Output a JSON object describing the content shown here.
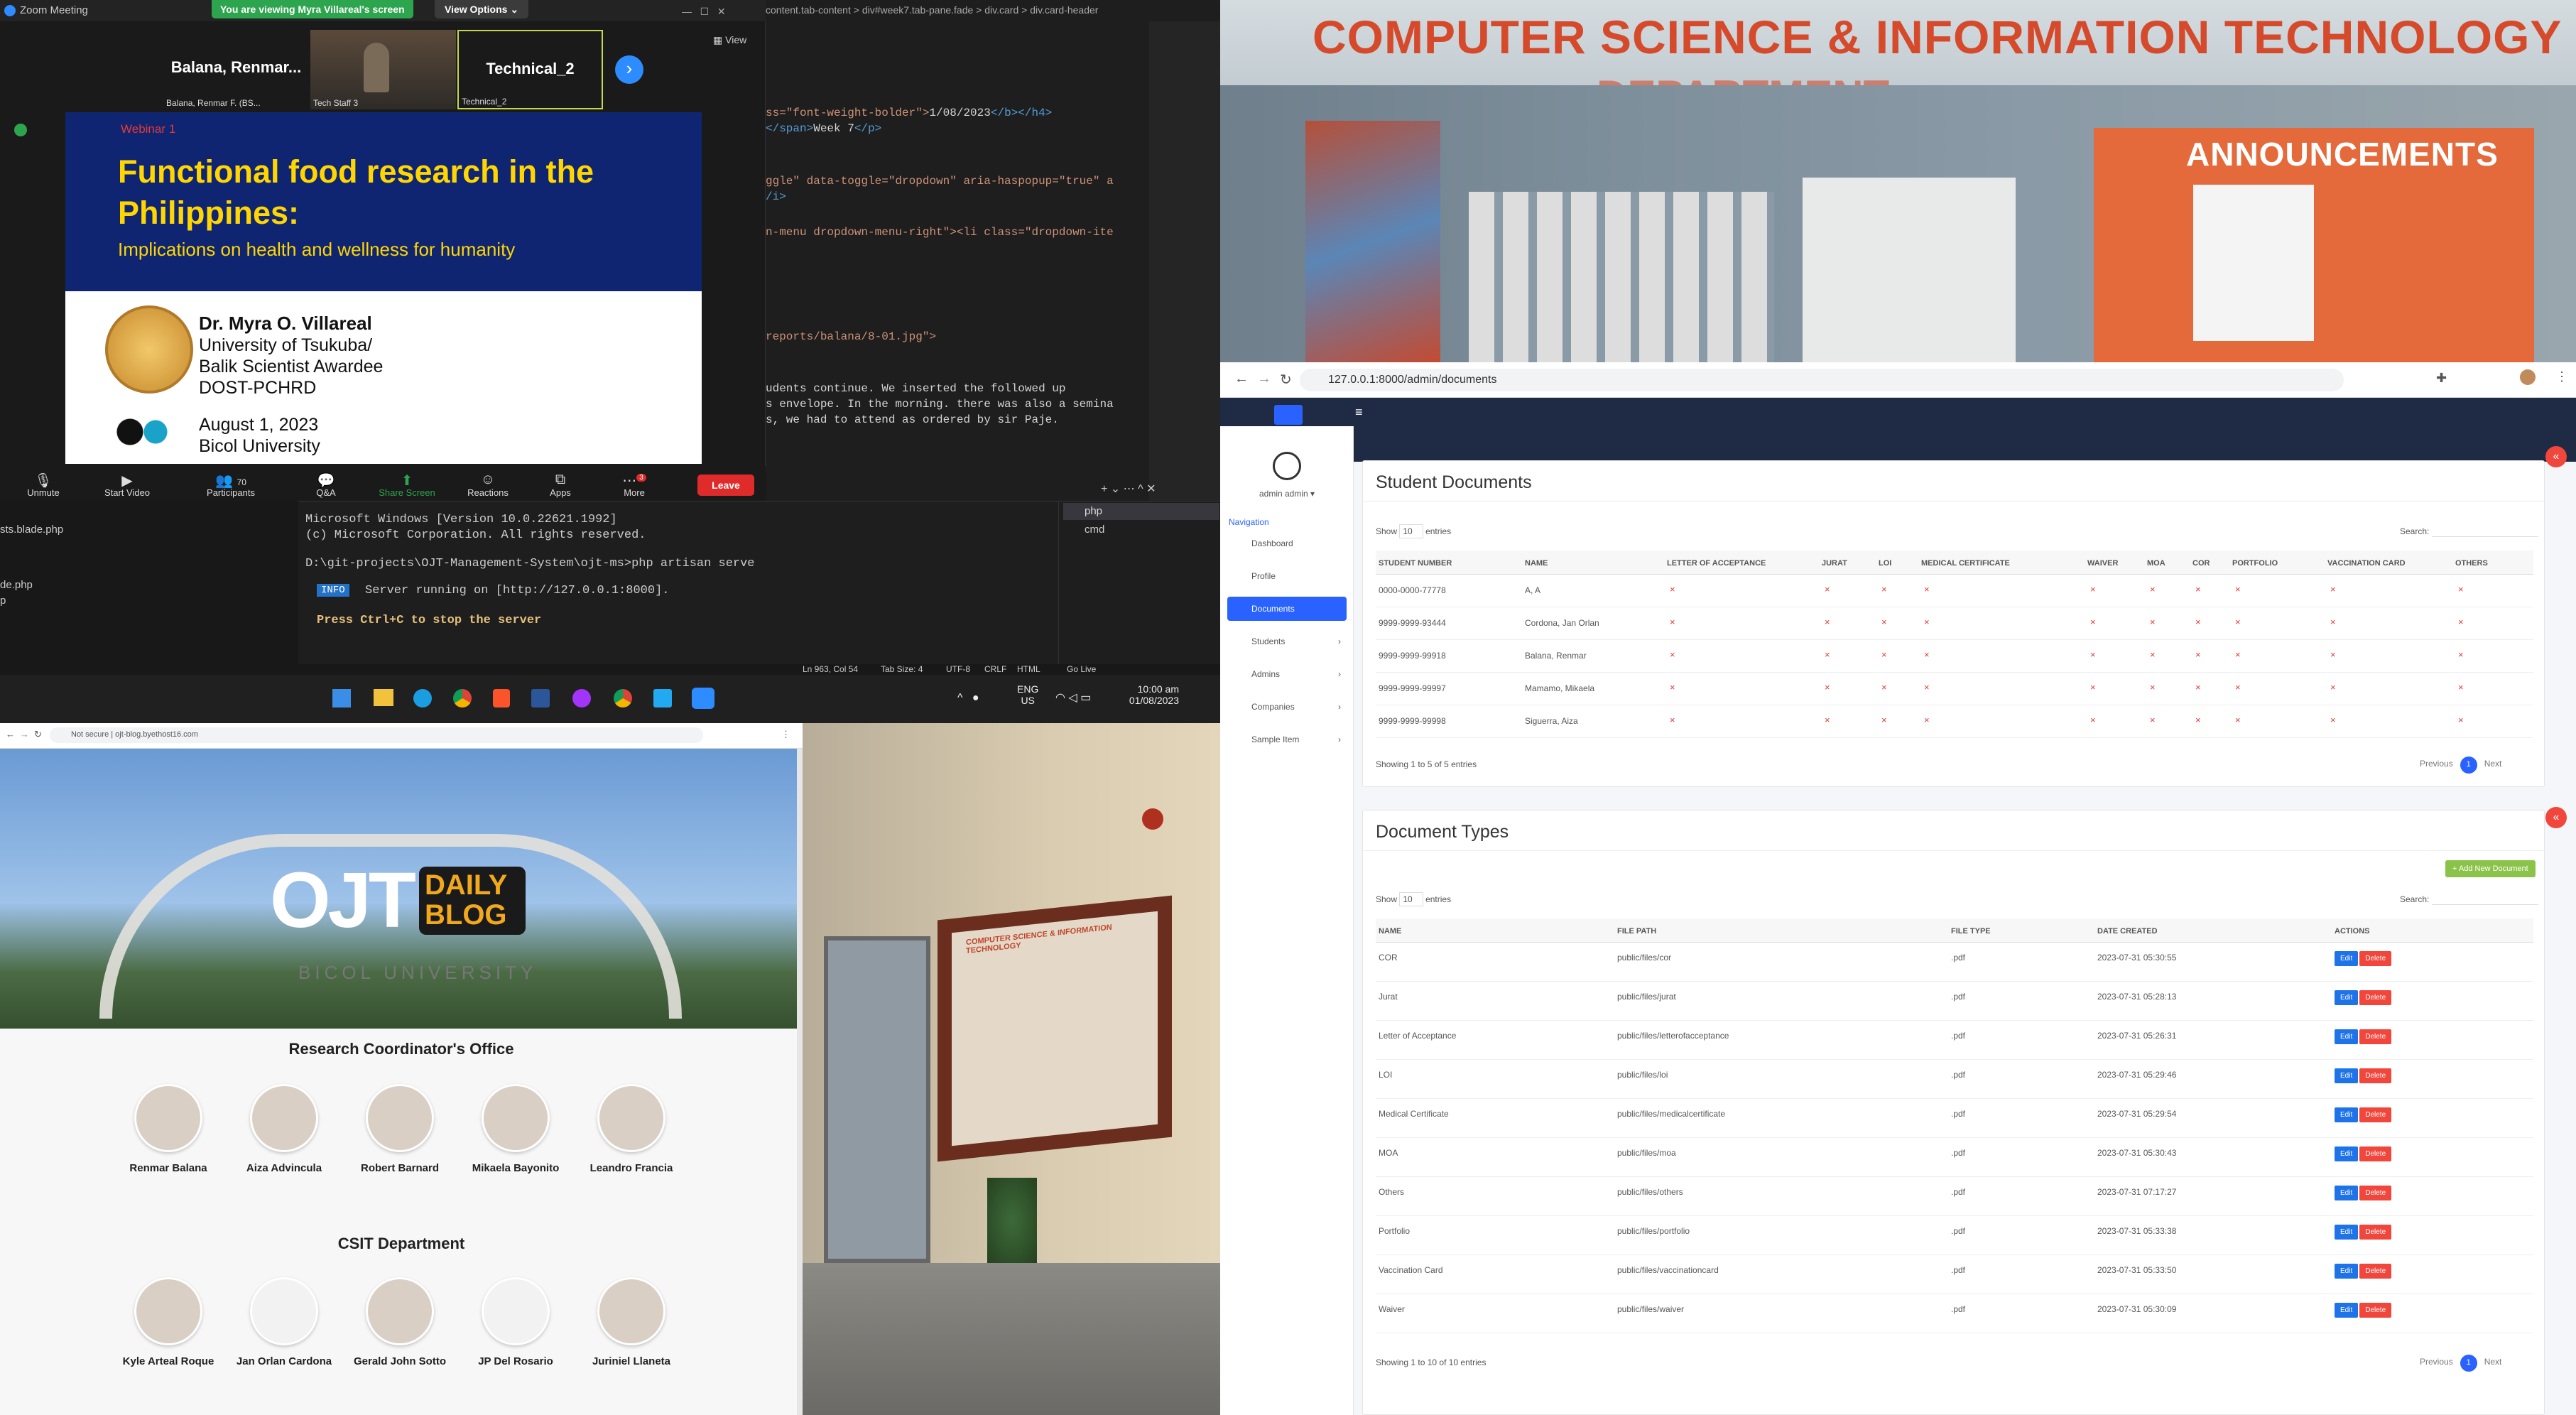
{
  "zoom": {
    "window_title": "Zoom Meeting",
    "banner": "You are viewing Myra Villareal's screen",
    "view_options": "View Options",
    "view_label": "View",
    "participants_tiles": [
      {
        "name": "Balana,  Renmar...",
        "caption": "Balana, Renmar F. (BS..."
      },
      {
        "name": "",
        "caption": "Tech Staff 3"
      },
      {
        "name": "Technical_2",
        "caption": "Technical_2"
      }
    ],
    "slide": {
      "tag": "Webinar 1",
      "title_line1": "Functional food research in the",
      "title_line2": "Philippines:",
      "subtitle": "Implications on health and wellness for humanity",
      "speaker": "Dr. Myra O. Villareal",
      "affil1": "University of Tsukuba/",
      "affil2": "Balik Scientist Awardee",
      "affil3": "DOST-PCHRD",
      "date": "August 1, 2023",
      "venue": "Bicol University"
    },
    "toolbar": [
      {
        "label": "Unmute",
        "icon": "mic-off-icon"
      },
      {
        "label": "Start Video",
        "icon": "video-off-icon"
      },
      {
        "label": "Participants",
        "icon": "participants-icon",
        "count": "70"
      },
      {
        "label": "Q&A",
        "icon": "qa-icon"
      },
      {
        "label": "Share Screen",
        "icon": "share-screen-icon"
      },
      {
        "label": "Reactions",
        "icon": "reactions-icon"
      },
      {
        "label": "Apps",
        "icon": "apps-icon"
      },
      {
        "label": "More",
        "icon": "more-icon",
        "badge": "3"
      }
    ],
    "leave": "Leave"
  },
  "editor": {
    "breadcrumb": [
      "content.tab-content",
      "div#week7.tab-pane.fade",
      "div.card",
      "div.card-header"
    ],
    "lines": [
      {
        "a": "ss=\"font-weight-bolder\">",
        "b": "1/08/2023",
        "c": "</b></h4>"
      },
      {
        "a": "</span>",
        "b": "Week 7",
        "c": "</p>"
      },
      {
        "a": "ggle\" data-toggle=\"dropdown\" aria-haspopup=\"true\" a",
        "b": "",
        "c": ""
      },
      {
        "a": "/i>",
        "b": "",
        "c": ""
      },
      {
        "a": "n-menu dropdown-menu-right\"><li class=\"dropdown-ite",
        "b": "",
        "c": ""
      },
      {
        "a": "reports/balana/8-01.jpg\">",
        "b": "",
        "c": ""
      },
      {
        "a": "udents continue. We inserted the followed up",
        "b": "",
        "c": ""
      },
      {
        "a": "s envelope. In the morning. there was also a semina",
        "b": "",
        "c": ""
      },
      {
        "a": "s, we had to attend as ordered by sir Paje.",
        "b": "",
        "c": ""
      }
    ],
    "files": [
      "sts.blade.php",
      "de.php",
      "p"
    ],
    "terminal_tabs": [
      "php",
      "cmd"
    ],
    "terminal": [
      "Microsoft Windows [Version 10.0.22621.1992]",
      "(c) Microsoft Corporation. All rights reserved.",
      "D:\\git-projects\\OJT-Management-System\\ojt-ms>php artisan serve",
      "INFO",
      "Server running on [http://127.0.0.1:8000].",
      "Press Ctrl+C to stop the server"
    ],
    "status": [
      "Ln 963, Col 54",
      "Tab Size: 4",
      "UTF-8",
      "CRLF",
      "HTML",
      "Go Live"
    ],
    "taskbar": {
      "lang1": "ENG",
      "lang2": "US",
      "time": "10:00 am",
      "date": "01/08/2023"
    }
  },
  "bulletin": {
    "banner_text": "COMPUTER SCIENCE & INFORMATION TECHNOLOGY",
    "banner_text2": "DEPARTMENT",
    "announcements": "ANNOUNCEMENTS"
  },
  "admin": {
    "url": "127.0.0.1:8000/admin/documents",
    "user": "admin admin",
    "nav_header": "Navigation",
    "nav": [
      "Dashboard",
      "Profile",
      "Documents",
      "Students",
      "Admins",
      "Companies",
      "Sample Item"
    ],
    "student_docs": {
      "title": "Student Documents",
      "show": "Show",
      "entries_value": "10",
      "entries": "entries",
      "search": "Search:",
      "columns": [
        "STUDENT NUMBER",
        "NAME",
        "LETTER OF ACCEPTANCE",
        "JURAT",
        "LOI",
        "MEDICAL CERTIFICATE",
        "WAIVER",
        "MOA",
        "COR",
        "PORTFOLIO",
        "VACCINATION CARD",
        "OTHERS"
      ],
      "rows": [
        {
          "num": "0000-0000-77778",
          "name": "A, A"
        },
        {
          "num": "9999-9999-93444",
          "name": "Cordona, Jan Orlan"
        },
        {
          "num": "9999-9999-99918",
          "name": "Balana, Renmar"
        },
        {
          "num": "9999-9999-99997",
          "name": "Mamamo, Mikaela"
        },
        {
          "num": "9999-9999-99998",
          "name": "Siguerra, Aiza"
        }
      ],
      "mark": "×",
      "info": "Showing 1 to 5 of 5 entries",
      "prev": "Previous",
      "page": "1",
      "next": "Next"
    },
    "doc_types": {
      "title": "Document Types",
      "add": "+ Add New Document",
      "show": "Show",
      "entries_value": "10",
      "entries": "entries",
      "search": "Search:",
      "columns": [
        "NAME",
        "FILE PATH",
        "FILE TYPE",
        "DATE CREATED",
        "ACTIONS"
      ],
      "rows": [
        {
          "name": "COR",
          "path": "public/files/cor",
          "type": ".pdf",
          "date": "2023-07-31 05:30:55"
        },
        {
          "name": "Jurat",
          "path": "public/files/jurat",
          "type": ".pdf",
          "date": "2023-07-31 05:28:13"
        },
        {
          "name": "Letter of Acceptance",
          "path": "public/files/letterofacceptance",
          "type": ".pdf",
          "date": "2023-07-31 05:26:31"
        },
        {
          "name": "LOI",
          "path": "public/files/loi",
          "type": ".pdf",
          "date": "2023-07-31 05:29:46"
        },
        {
          "name": "Medical Certificate",
          "path": "public/files/medicalcertificate",
          "type": ".pdf",
          "date": "2023-07-31 05:29:54"
        },
        {
          "name": "MOA",
          "path": "public/files/moa",
          "type": ".pdf",
          "date": "2023-07-31 05:30:43"
        },
        {
          "name": "Others",
          "path": "public/files/others",
          "type": ".pdf",
          "date": "2023-07-31 07:17:27"
        },
        {
          "name": "Portfolio",
          "path": "public/files/portfolio",
          "type": ".pdf",
          "date": "2023-07-31 05:33:38"
        },
        {
          "name": "Vaccination Card",
          "path": "public/files/vaccinationcard",
          "type": ".pdf",
          "date": "2023-07-31 05:33:50"
        },
        {
          "name": "Waiver",
          "path": "public/files/waiver",
          "type": ".pdf",
          "date": "2023-07-31 05:30:09"
        }
      ],
      "edit": "Edit",
      "delete": "Delete",
      "info": "Showing 1 to 10 of 10 entries",
      "prev": "Previous",
      "page": "1",
      "next": "Next"
    }
  },
  "blog": {
    "url": "Not secure | ojt-blog.byethost16.com",
    "logo_ojt": "OJT",
    "logo_daily": "DAILY",
    "logo_blog": "BLOG",
    "gate_text": "BICOL UNIVERSITY",
    "section1": "Research Coordinator's Office",
    "people1": [
      "Renmar Balana",
      "Aiza Advincula",
      "Robert Barnard",
      "Mikaela Bayonito",
      "Leandro Francia"
    ],
    "section2": "CSIT Department",
    "people2": [
      "Kyle Arteal Roque",
      "Jan Orlan Cardona",
      "Gerald John Sotto",
      "JP Del Rosario",
      "Juriniel Llaneta"
    ]
  },
  "hallway": {
    "board_text": "COMPUTER SCIENCE & INFORMATION TECHNOLOGY"
  }
}
